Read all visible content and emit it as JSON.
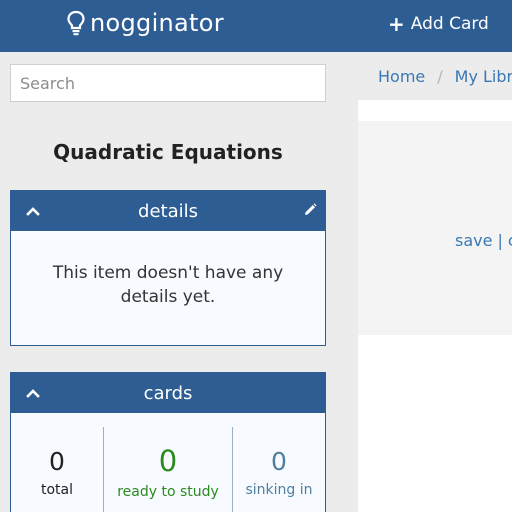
{
  "header": {
    "brand": "nogginator",
    "add_card_label": "Add Card",
    "brand_color": "#2e5d93"
  },
  "search": {
    "placeholder": "Search",
    "value": ""
  },
  "item": {
    "title": "Quadratic Equations"
  },
  "details": {
    "heading": "details",
    "empty_message": "This item doesn't have any details yet."
  },
  "cards": {
    "heading": "cards",
    "stats": [
      {
        "value": "0",
        "label": "total",
        "color": "#222222"
      },
      {
        "value": "0",
        "label": "ready to study",
        "color": "#2b8a1e"
      },
      {
        "value": "0",
        "label": "sinking in",
        "color": "#4f7f9d"
      }
    ]
  },
  "breadcrumb": {
    "items": [
      "Home",
      "My Libra"
    ],
    "separator": "/"
  },
  "card_actions": {
    "save_label": "save",
    "separator": "|",
    "next_label": "c"
  },
  "icons": {
    "brand": "lightbulb-icon",
    "add": "plus-icon",
    "collapse": "chevron-up-icon",
    "edit": "pencil-icon"
  }
}
